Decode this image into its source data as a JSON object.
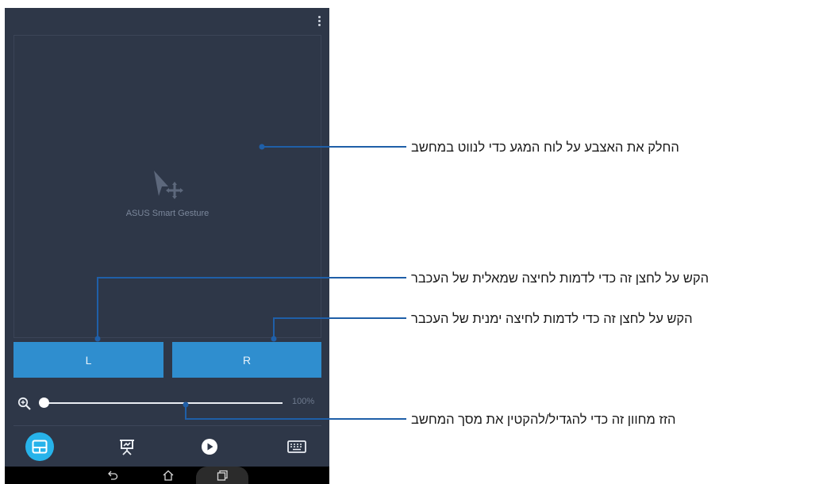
{
  "app": {
    "caption": "ASUS Smart Gesture",
    "mouse_buttons": {
      "left_label": "L",
      "right_label": "R"
    },
    "zoom": {
      "value": 0.0,
      "value_text": "100%"
    },
    "bottom_tabs": [
      {
        "id": "touchpad",
        "icon": "touchpad-icon",
        "active": true
      },
      {
        "id": "presentation",
        "icon": "presentation-icon",
        "active": false
      },
      {
        "id": "media",
        "icon": "play-icon",
        "active": false
      },
      {
        "id": "keyboard",
        "icon": "keyboard-icon",
        "active": false
      }
    ],
    "system_nav": [
      "back-icon",
      "home-icon",
      "recent-apps-icon"
    ]
  },
  "callouts": {
    "touchpad": "החלק את האצבע על לוח המגע כדי לנווט במחשב",
    "left_click": "הקש על לחצן זה כדי לדמות לחיצה שמאלית של העכבר",
    "right_click": "הקש על לחצן זה כדי לדמות לחיצה ימנית של העכבר",
    "zoom": "הזז מחוון זה כדי להגדיל/להקטין את מסך המחשב"
  },
  "colors": {
    "app_background": "#2e3748",
    "button_blue": "#2f8ecf",
    "active_tab": "#27b3ea",
    "callout_line": "#1f5fa8"
  }
}
